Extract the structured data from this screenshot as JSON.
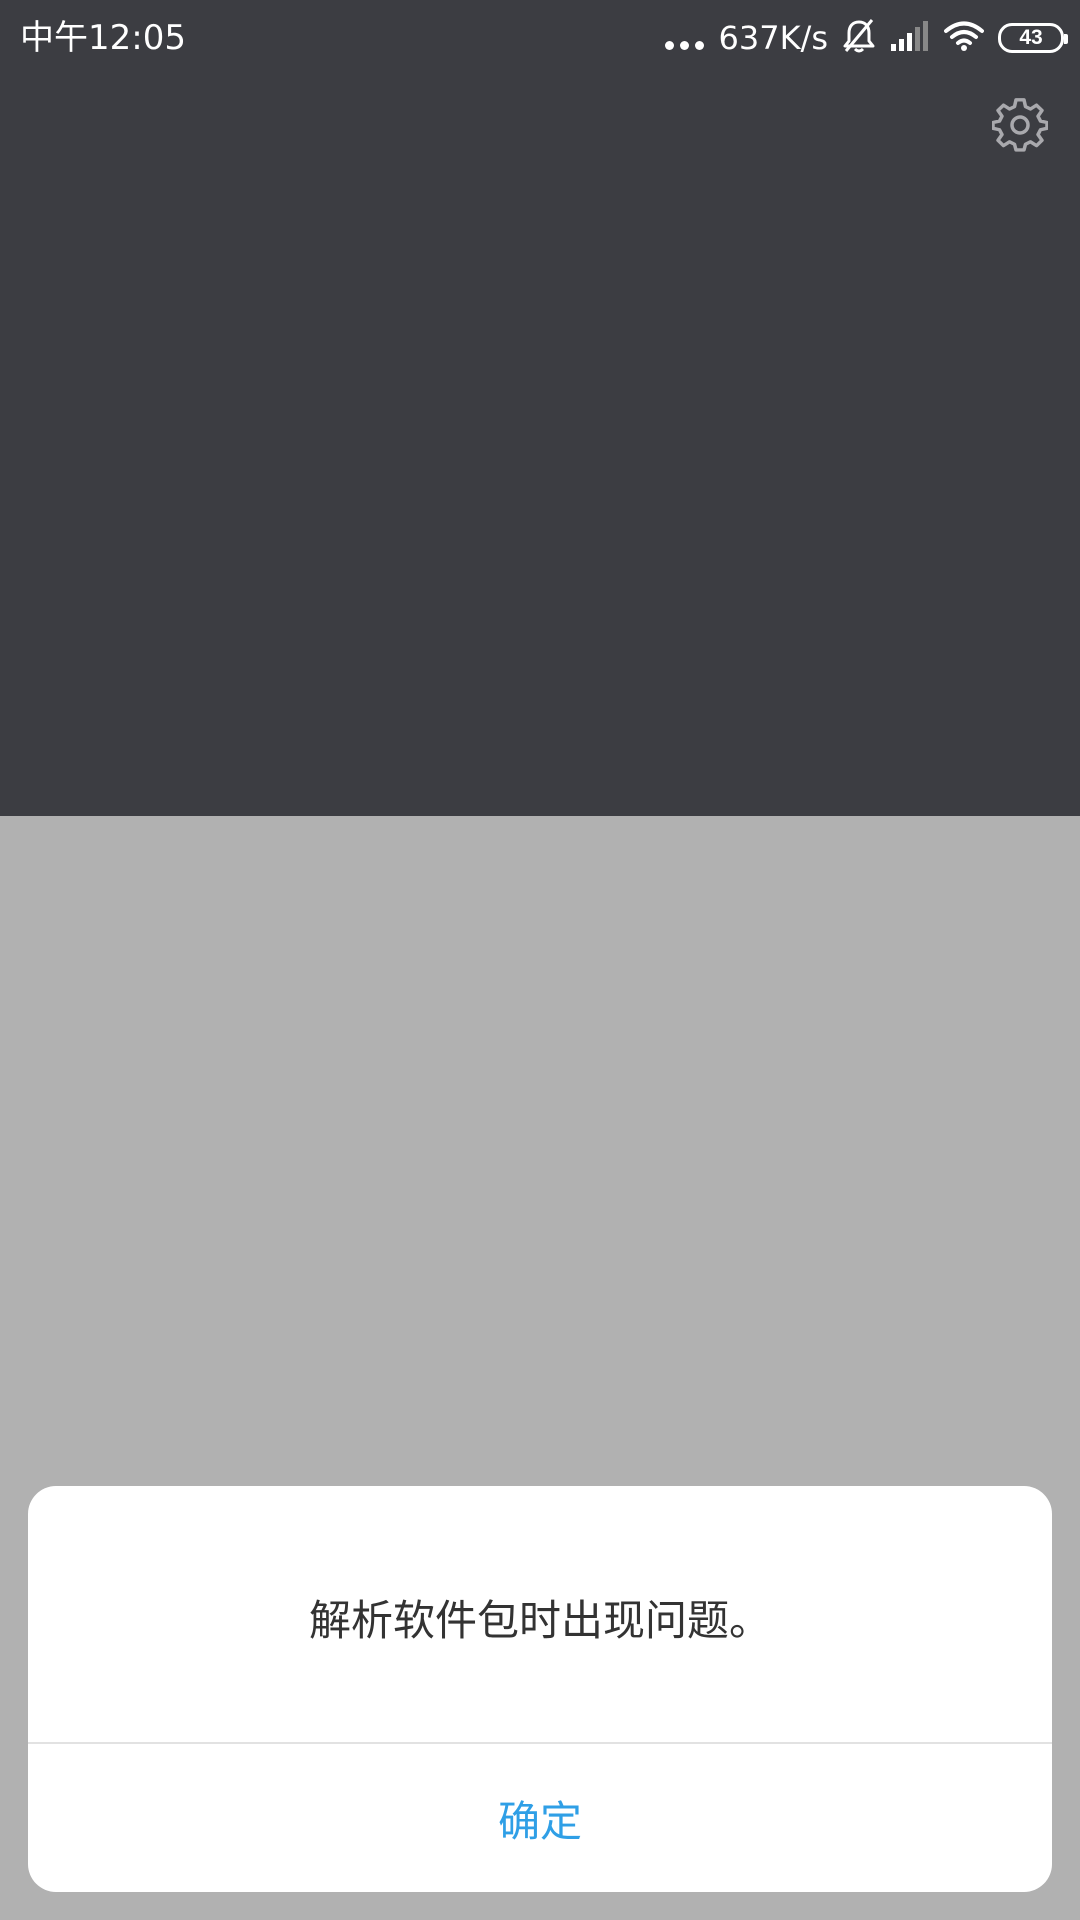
{
  "status_bar": {
    "time": "中午12:05",
    "net_speed": "637K/s",
    "battery_level": "43",
    "icons": [
      "more-dots-icon",
      "bell-muted-icon",
      "signal-icon",
      "wifi-icon",
      "battery-icon"
    ]
  },
  "header": {
    "settings_icon": "gear-icon"
  },
  "dialog": {
    "message": "解析软件包时出现问题。",
    "confirm_label": "确定"
  },
  "colors": {
    "background": "#3c3d42",
    "overlay": "#b1b1b1",
    "dialog": "#ffffff",
    "accent": "#2f9fe6"
  }
}
